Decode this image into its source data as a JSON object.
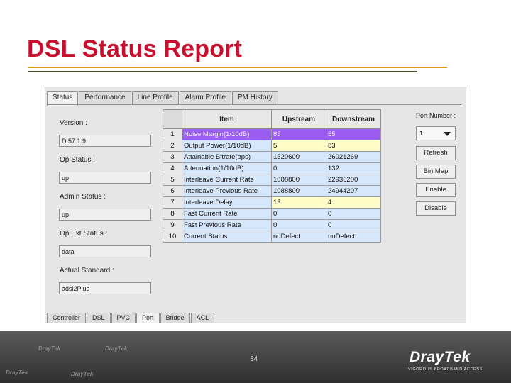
{
  "slide": {
    "title": "DSL Status Report",
    "page_number": "34"
  },
  "tabs": [
    "Status",
    "Performance",
    "Line Profile",
    "Alarm Profile",
    "PM History"
  ],
  "bottom_tabs": [
    "Controller",
    "DSL",
    "PVC",
    "Port",
    "Bridge",
    "ACL"
  ],
  "left_fields": [
    {
      "label": "Version :",
      "value": "D.57.1.9"
    },
    {
      "label": "Op Status :",
      "value": "up"
    },
    {
      "label": "Admin Status :",
      "value": "up"
    },
    {
      "label": "Op Ext Status :",
      "value": "data"
    },
    {
      "label": "Actual Standard :",
      "value": "adsl2Plus"
    }
  ],
  "table": {
    "headers": {
      "item": "Item",
      "upstream": "Upstream",
      "downstream": "Downstream"
    },
    "rows": [
      {
        "no": "1",
        "item": "Noise Margin(1/10dB)",
        "up": "85",
        "down": "55"
      },
      {
        "no": "2",
        "item": "Output Power(1/10dB)",
        "up": "5",
        "down": "83"
      },
      {
        "no": "3",
        "item": "Attainable Bitrate(bps)",
        "up": "1320600",
        "down": "26021269"
      },
      {
        "no": "4",
        "item": "Attenuation(1/10dB)",
        "up": "0",
        "down": "132"
      },
      {
        "no": "5",
        "item": "Interleave Current Rate",
        "up": "1088800",
        "down": "22936200"
      },
      {
        "no": "6",
        "item": "Interleave Previous Rate",
        "up": "1088800",
        "down": "24944207"
      },
      {
        "no": "7",
        "item": "Interleave Delay",
        "up": "13",
        "down": "4"
      },
      {
        "no": "8",
        "item": "Fast Current Rate",
        "up": "0",
        "down": "0"
      },
      {
        "no": "9",
        "item": "Fast Previous Rate",
        "up": "0",
        "down": "0"
      },
      {
        "no": "10",
        "item": "Current Status",
        "up": "noDefect",
        "down": "noDefect"
      }
    ]
  },
  "right_panel": {
    "port_label": "Port Number :",
    "port_value": "1",
    "buttons": {
      "refresh": "Refresh",
      "bin_map": "Bin Map",
      "enable": "Enable",
      "disable": "Disable"
    }
  },
  "footer": {
    "brand": "DrayTek",
    "tagline": "VIGOROUS BROADBAND ACCESS",
    "watermarks": [
      "DrayTek",
      "DrayTek",
      "DrayTek",
      "DrayTek"
    ]
  },
  "colors": {
    "title": "#c8102e",
    "selected_row": "#9b5cf0",
    "row_bg": "#d6e6fb",
    "highlight_cell": "#fffcc8",
    "gold_rule": "#d4a017"
  }
}
